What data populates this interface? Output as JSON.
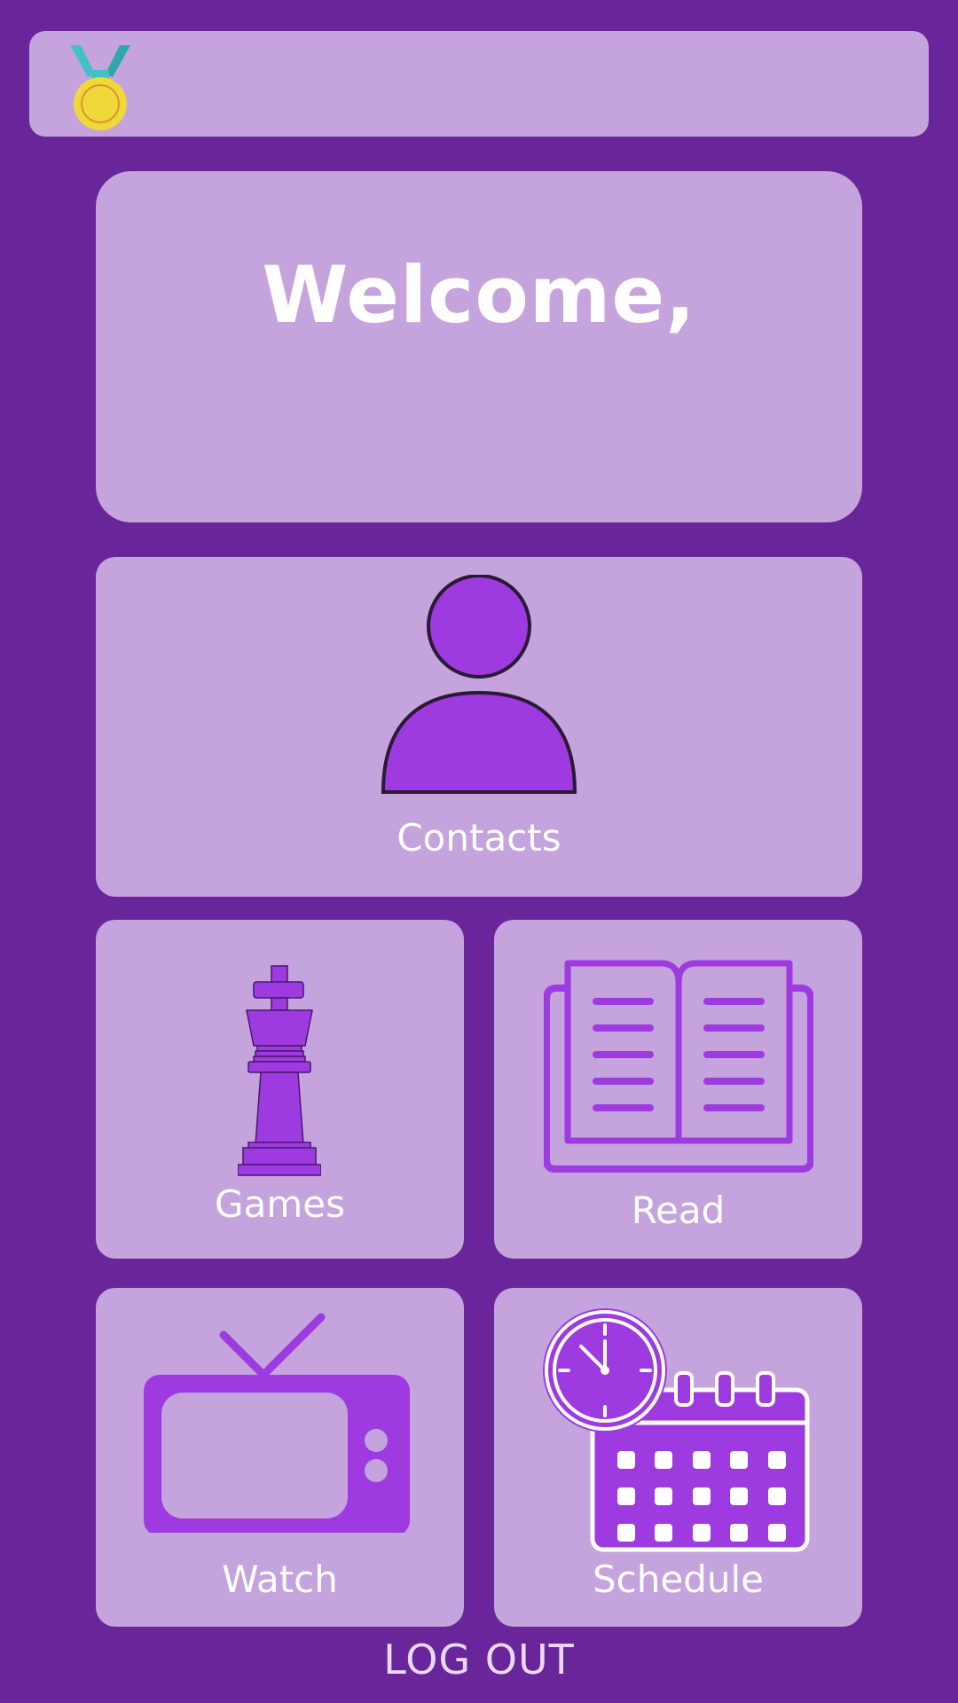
{
  "colors": {
    "background": "#69259a",
    "card": "#c5a3dd",
    "icon_purple": "#9d3ae0",
    "text": "#ffffff"
  },
  "header": {
    "badge_icon": "medal-icon"
  },
  "welcome": {
    "title": "Welcome,"
  },
  "tiles": {
    "contacts": {
      "label": "Contacts",
      "icon": "person-icon"
    },
    "games": {
      "label": "Games",
      "icon": "chess-king-icon"
    },
    "read": {
      "label": "Read",
      "icon": "open-book-icon"
    },
    "watch": {
      "label": "Watch",
      "icon": "tv-icon"
    },
    "schedule": {
      "label": "Schedule",
      "icon": "clock-calendar-icon"
    }
  },
  "footer": {
    "logout_label": "LOG OUT"
  }
}
